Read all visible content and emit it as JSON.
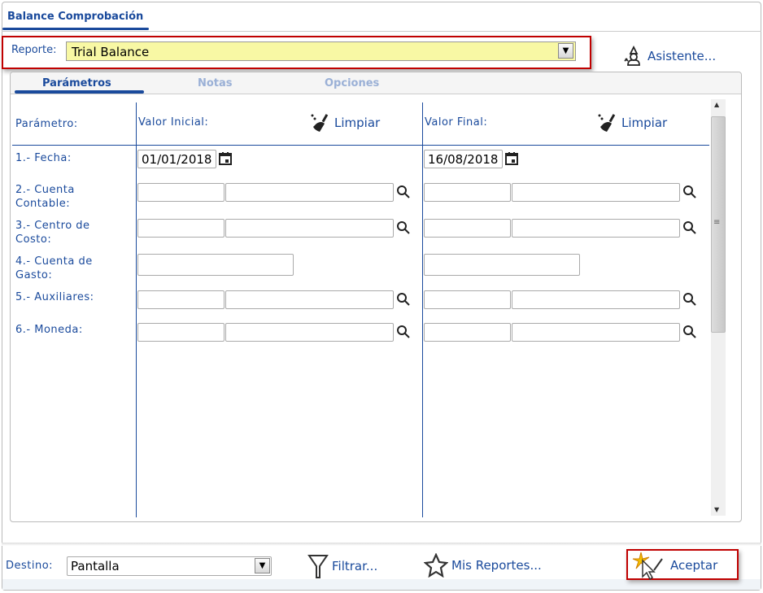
{
  "window": {
    "tab_title": "Balance Comprobación"
  },
  "report": {
    "label": "Reporte:",
    "value": "Trial Balance",
    "wizard_label": "Asistente..."
  },
  "tabs": [
    {
      "label": "Parámetros",
      "active": true
    },
    {
      "label": "Notas"
    },
    {
      "label": "Opciones"
    }
  ],
  "params": {
    "header_param": "Parámetro:",
    "header_initial": "Valor Inicial:",
    "header_final": "Valor Final:",
    "clear_label": "Limpiar",
    "rows": [
      {
        "label": "1.- Fecha:",
        "initial": "01/01/2018",
        "final": "16/08/2018"
      },
      {
        "label": "2.- Cuenta Contable:"
      },
      {
        "label": "3.- Centro de Costo:"
      },
      {
        "label": "4.- Cuenta de Gasto:"
      },
      {
        "label": "5.- Auxiliares:"
      },
      {
        "label": "6.- Moneda:"
      }
    ]
  },
  "footer": {
    "dest_label": "Destino:",
    "dest_value": "Pantalla",
    "filter_label": "Filtrar...",
    "my_reports_label": "Mis Reportes...",
    "accept_label": "Aceptar"
  },
  "colors": {
    "accent": "#1a4a9c",
    "highlight": "#c00000",
    "select_bg": "#f8f8a4"
  }
}
